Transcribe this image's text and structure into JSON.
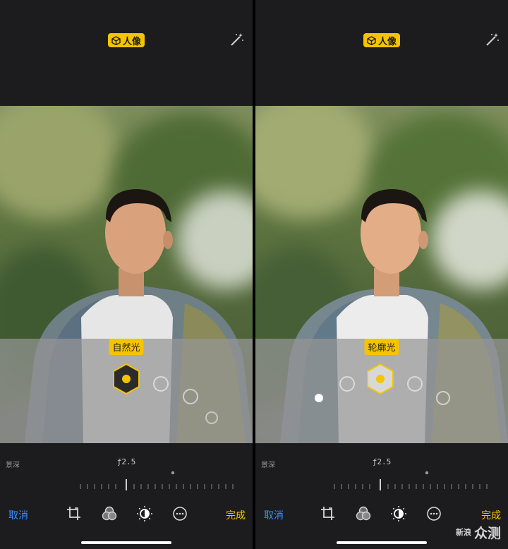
{
  "panels": [
    {
      "badge_label": "人像",
      "lighting_label": "自然光",
      "depth_label": "景深",
      "aperture": "ƒ2.5",
      "cancel_label": "取消",
      "done_label": "完成"
    },
    {
      "badge_label": "人像",
      "lighting_label": "轮廓光",
      "depth_label": "景深",
      "aperture": "ƒ2.5",
      "cancel_label": "取消",
      "done_label": "完成"
    }
  ],
  "watermark": {
    "brand_small": "新浪",
    "brand_large": "众测"
  },
  "colors": {
    "accent": "#f5c400",
    "link": "#3d8bff",
    "chrome": "#1c1c1e"
  },
  "icons": [
    "cube-icon",
    "magic-wand-icon",
    "crop-icon",
    "filters-icon",
    "adjust-icon",
    "more-icon"
  ]
}
